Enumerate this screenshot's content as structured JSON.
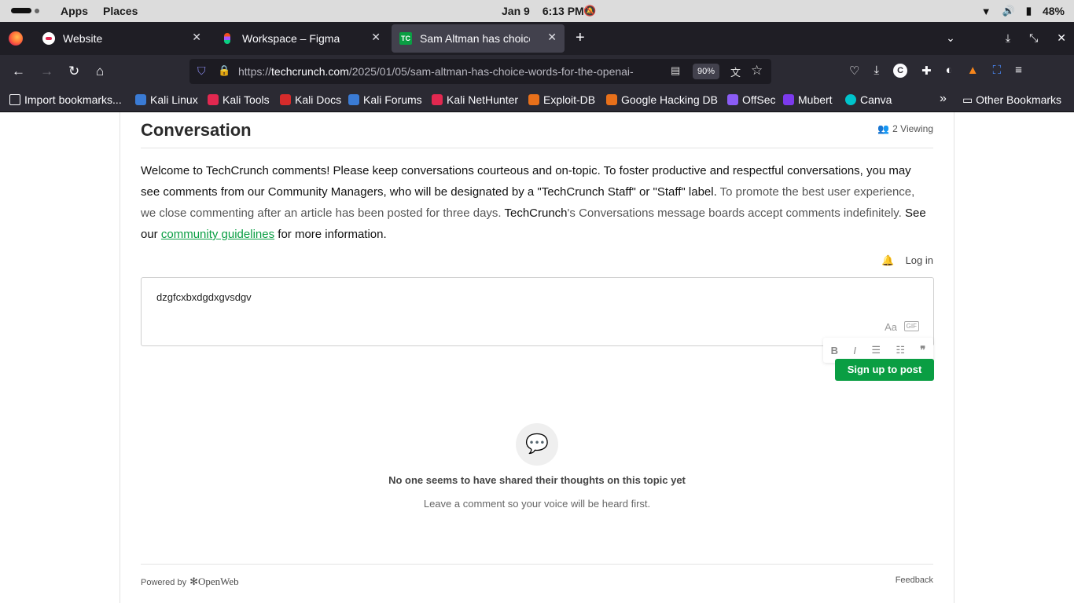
{
  "topbar": {
    "apps": "Apps",
    "places": "Places",
    "date": "Jan 9",
    "time": "6:13 PM",
    "battery": "48%"
  },
  "tabs": [
    {
      "title": "Website"
    },
    {
      "title": "Workspace – Figma"
    },
    {
      "title": "Sam Altman has choice wo",
      "favicon_text": "TC"
    }
  ],
  "navbar": {
    "url_prefix": "https://",
    "url_domain": "techcrunch.com",
    "url_path": "/2025/01/05/sam-altman-has-choice-words-for-the-openai-",
    "zoom": "90%"
  },
  "bookmarks": [
    {
      "label": "Import bookmarks...",
      "color": "#fbfbfe"
    },
    {
      "label": "Kali Linux",
      "color": "#3a7bd5"
    },
    {
      "label": "Kali Tools",
      "color": "#e22850"
    },
    {
      "label": "Kali Docs",
      "color": "#d62b2b"
    },
    {
      "label": "Kali Forums",
      "color": "#3a7bd5"
    },
    {
      "label": "Kali NetHunter",
      "color": "#e22850"
    },
    {
      "label": "Exploit-DB",
      "color": "#e8701a"
    },
    {
      "label": "Google Hacking DB",
      "color": "#e8701a"
    },
    {
      "label": "OffSec",
      "color": "#8b5cf6"
    },
    {
      "label": "Mubert",
      "color": "#7c3aed"
    },
    {
      "label": "Canva",
      "color": "#00c4cc"
    }
  ],
  "bookmarks_other": "Other Bookmarks",
  "conversation": {
    "title": "Conversation",
    "viewing": "2 Viewing",
    "intro_1": "Welcome to TechCrunch comments! Please keep conversations courteous and on-topic. To foster productive and respectful conversations, you may see comments from our Community Managers, who will be designated by a \"TechCrunch Staff\" or \"Staff\" label.",
    "intro_2": " To promote the best user experience, we close commenting after an article has been posted for three days.",
    "intro_3": " TechCrunch",
    "intro_4": "'s Conversations message boards accept comments indefinitely.",
    "intro_5": " See our ",
    "guidelines_link": "community guidelines",
    "intro_6": " for more information.",
    "login": "Log in",
    "editor_text": "dzgfcxbxdgdxgvsdgv",
    "editor_aa": "Aa",
    "editor_gif": "GIF",
    "signup_button": "Sign up to post",
    "empty_title": "No one seems to have shared their thoughts on this topic yet",
    "empty_sub": "Leave a comment so your voice will be heard first.",
    "powered_by": "Powered by",
    "openweb": "OpenWeb",
    "feedback": "Feedback"
  }
}
